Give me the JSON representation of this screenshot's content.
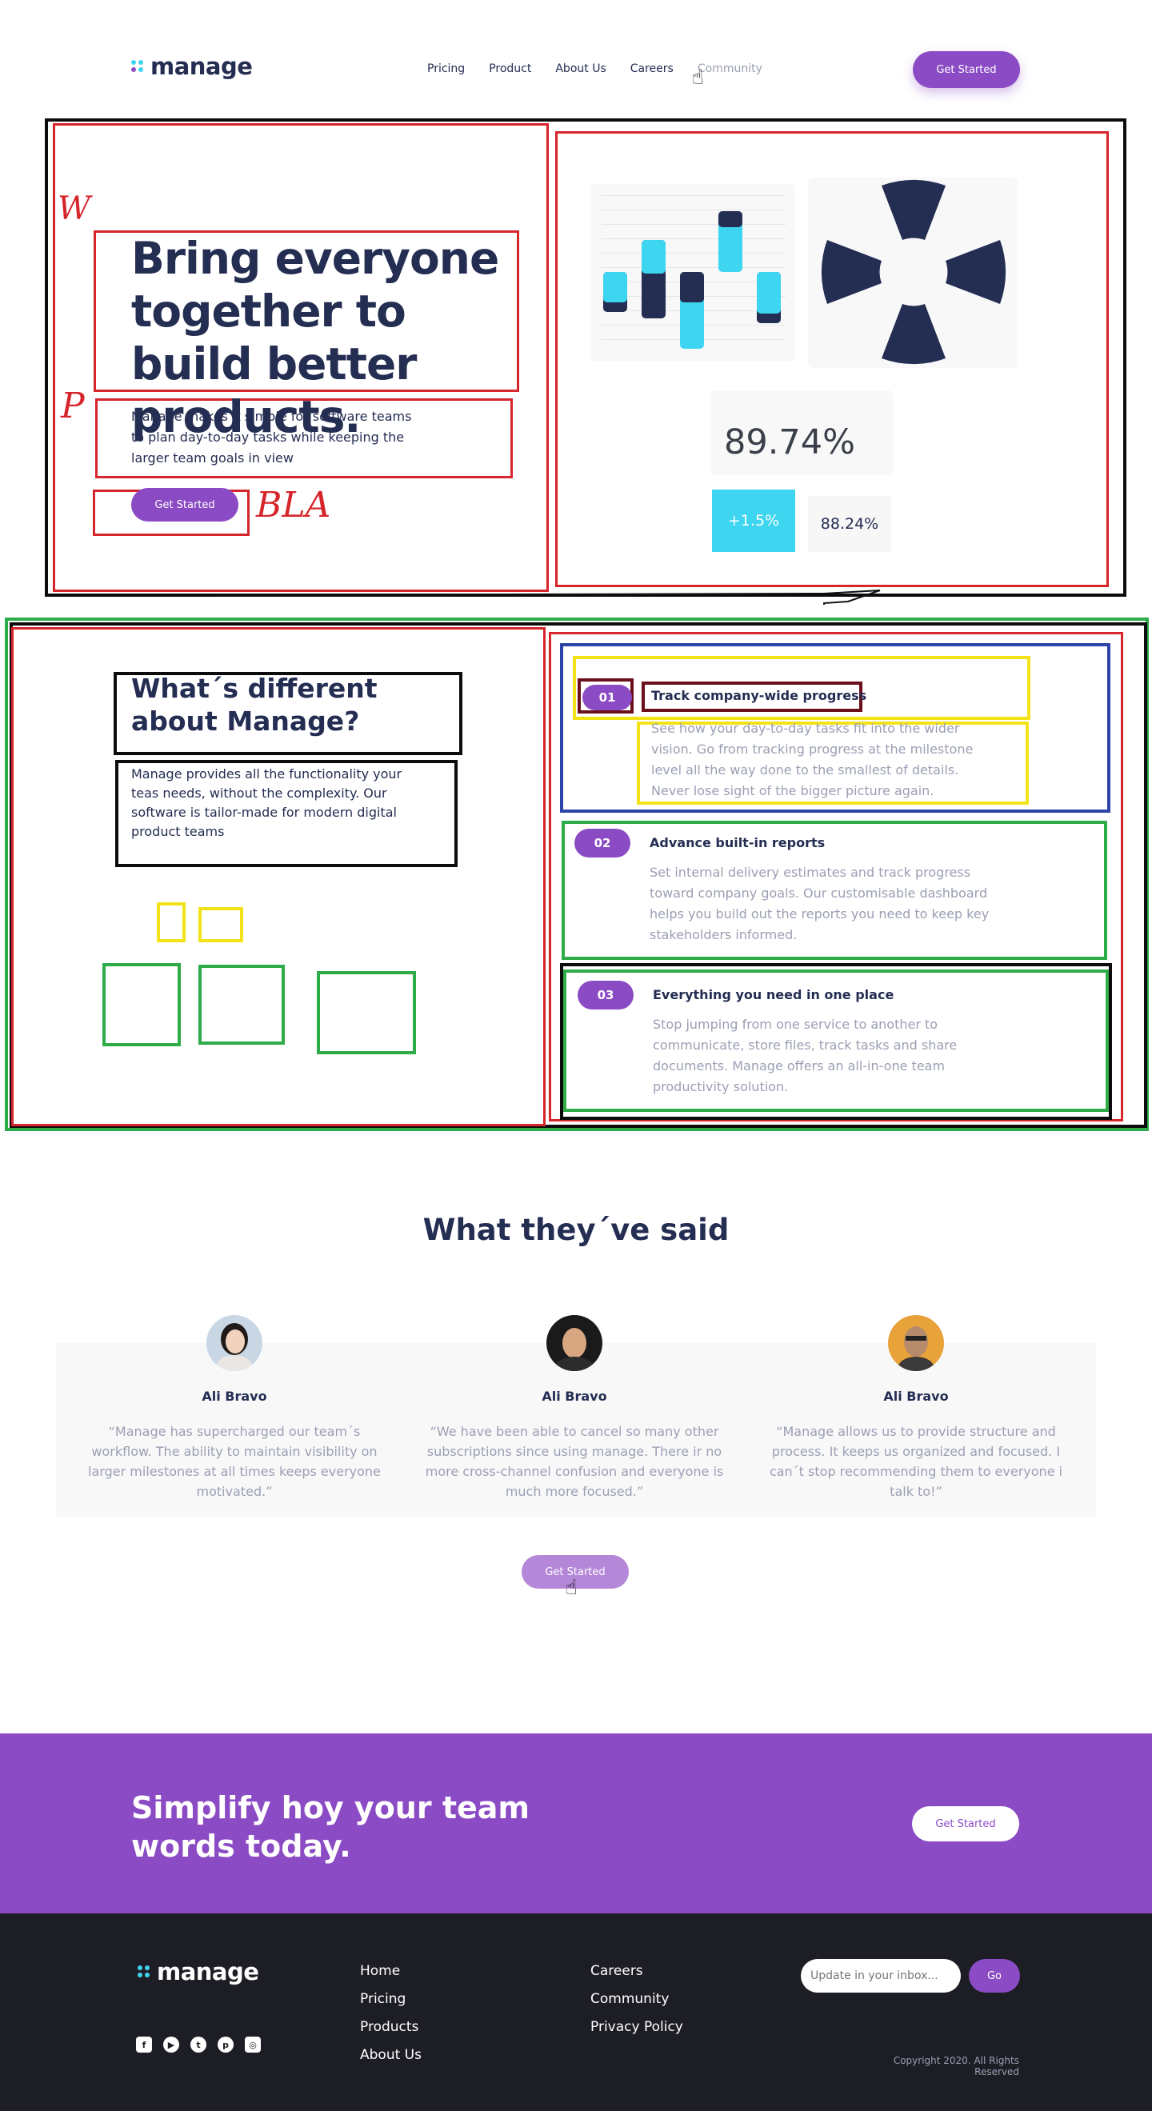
{
  "brand": {
    "name": "manage",
    "accent": "#8b4bc4",
    "dark": "#242d52",
    "cyan": "#3dd5ef"
  },
  "nav": {
    "links": [
      "Pricing",
      "Product",
      "About Us",
      "Careers",
      "Community"
    ],
    "cta": "Get Started"
  },
  "hero": {
    "title": "Bring everyone together to build better products.",
    "subtitle": "Manage makes it simple for software teams to plan day-to-day tasks while keeping the larger team goals in view",
    "cta": "Get Started",
    "annotations": [
      "W",
      "P",
      "BLA"
    ],
    "stats": {
      "main": "89.74%",
      "change": "+1.5%",
      "secondary": "88.24%"
    }
  },
  "different": {
    "title": "What´s different about Manage?",
    "subtitle": "Manage provides all the functionality your teas needs, without the complexity. Our software is tailor-made for modern digital product teams",
    "features": [
      {
        "num": "01",
        "title": "Track company-wide progress",
        "desc": "See how your day-to-day tasks fit into the wider vision. Go from tracking progress at the milestone level all the way done to the smallest of details. Never lose sight of the bigger picture again."
      },
      {
        "num": "02",
        "title": "Advance built-in reports",
        "desc": "Set internal delivery estimates and track progress toward company goals. Our customisable dashboard helps you build out the reports you need to keep key stakeholders informed."
      },
      {
        "num": "03",
        "title": "Everything you need in one place",
        "desc": "Stop jumping from one service to another to communicate, store files, track tasks and share documents. Manage offers an all-in-one team productivity solution."
      }
    ]
  },
  "testimonials": {
    "title": "What they´ve said",
    "items": [
      {
        "name": "Ali Bravo",
        "quote": "“Manage has supercharged our team´s workflow. The ability to maintain visibility on larger milestones at all times keeps everyone motivated.”"
      },
      {
        "name": "Ali Bravo",
        "quote": "“We have been able to cancel so many other subscriptions since using manage. There ir no more cross-channel confusion and everyone is much more focused.”"
      },
      {
        "name": "Ali Bravo",
        "quote": "“Manage allows us to provide structure and process. It keeps us organized and focused. I can´t stop recommending them to everyone i talk to!”"
      }
    ],
    "cta": "Get Started"
  },
  "cta": {
    "title": "Simplify hoy your team words today.",
    "button": "Get Started"
  },
  "footer": {
    "col1": [
      "Home",
      "Pricing",
      "Products",
      "About Us"
    ],
    "col2": [
      "Careers",
      "Community",
      "Privacy Policy"
    ],
    "subscribe_placeholder": "Update in your inbox...",
    "go": "Go",
    "copyright": "Copyright 2020. All Rights Reserved",
    "socials": [
      "facebook-icon",
      "youtube-icon",
      "twitter-icon",
      "pinterest-icon",
      "instagram-icon"
    ]
  }
}
